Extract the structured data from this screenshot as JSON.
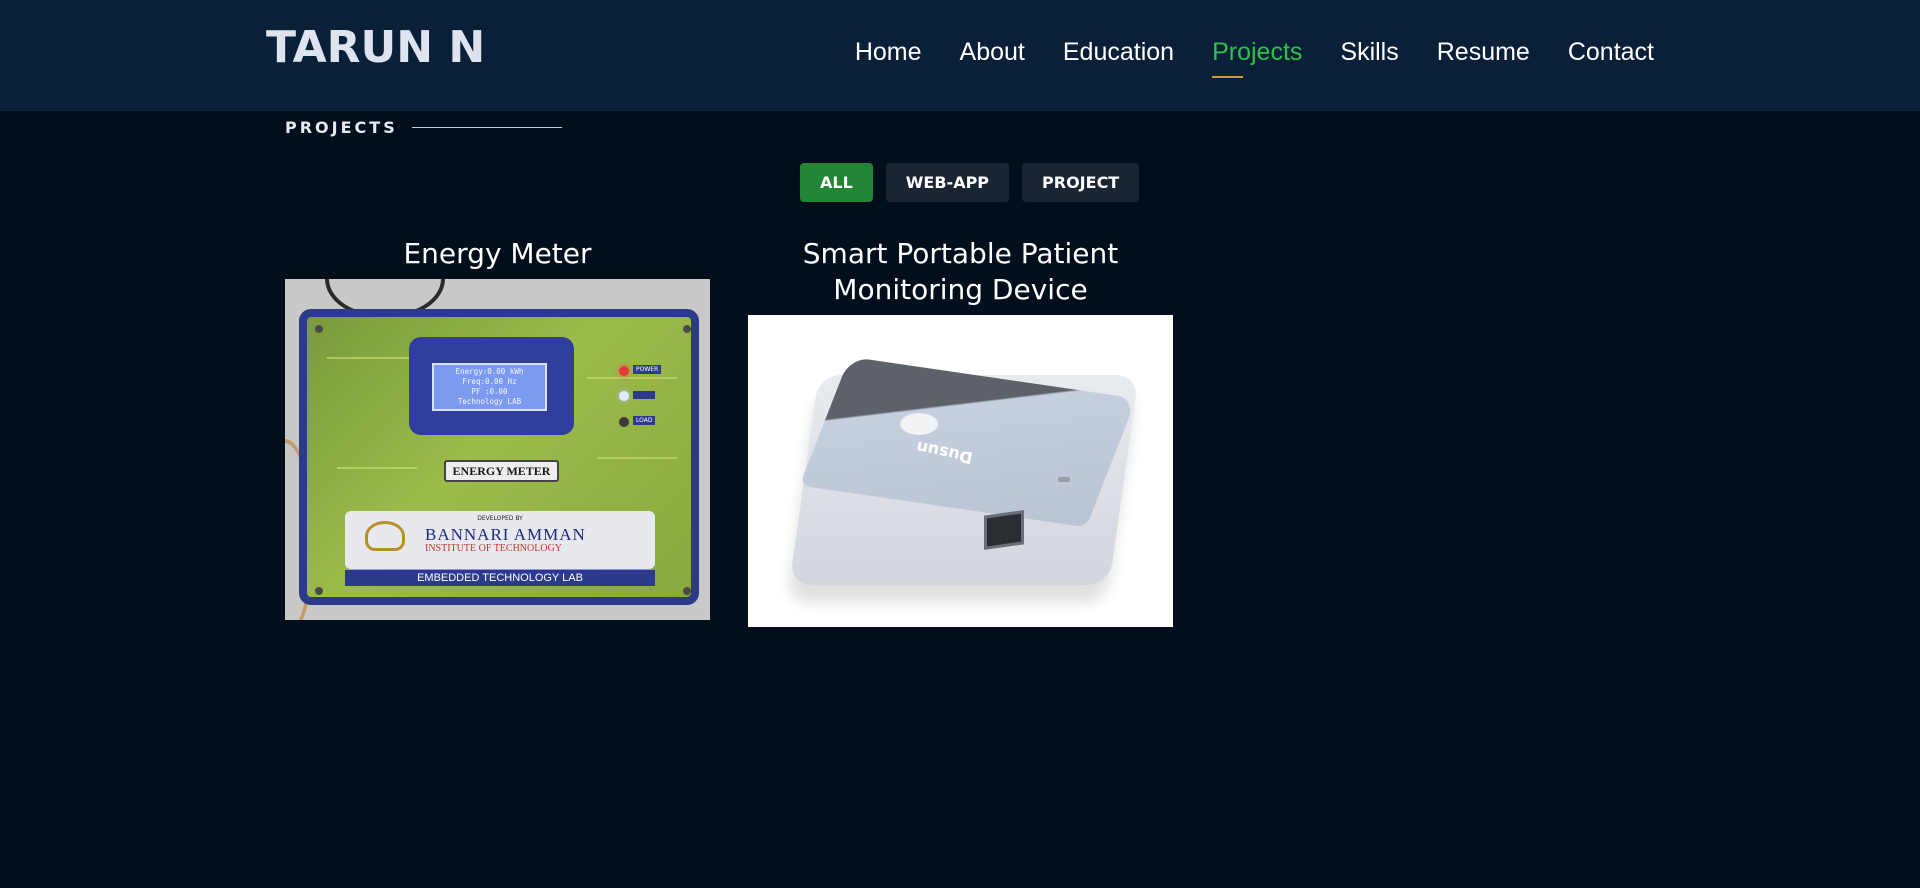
{
  "brand": "TARUN N",
  "nav": {
    "items": [
      {
        "label": "Home"
      },
      {
        "label": "About"
      },
      {
        "label": "Education"
      },
      {
        "label": "Projects"
      },
      {
        "label": "Skills"
      },
      {
        "label": "Resume"
      },
      {
        "label": "Contact"
      }
    ],
    "active": "Projects"
  },
  "section": {
    "title": "PROJECTS"
  },
  "filters": [
    {
      "label": "ALL",
      "active": true
    },
    {
      "label": "WEB-APP",
      "active": false
    },
    {
      "label": "PROJECT",
      "active": false
    }
  ],
  "projects": [
    {
      "title": "Energy Meter",
      "image": {
        "lcd_lines": [
          "Energy:0.00 kWh",
          "Freq:0.00 Hz",
          "PF :0.00",
          "Technology LAB"
        ],
        "indicator_labels": [
          "POWER",
          "",
          "LOAD"
        ],
        "plate": "ENERGY METER",
        "developed_by": "DEVELOPED BY",
        "institute": "BANNARI AMMAN",
        "institute_sub": "INSTITUTE OF TECHNOLOGY",
        "lab": "EMBEDDED TECHNOLOGY LAB"
      }
    },
    {
      "title": "Smart Portable Patient Monitoring Device",
      "image": {
        "brand_text": "Dusun"
      }
    }
  ],
  "colors": {
    "background": "#010e1c",
    "navbar": "#0a1f38",
    "active_link": "#2fbf4a",
    "active_filter": "#238636",
    "filter": "#1a2534"
  }
}
